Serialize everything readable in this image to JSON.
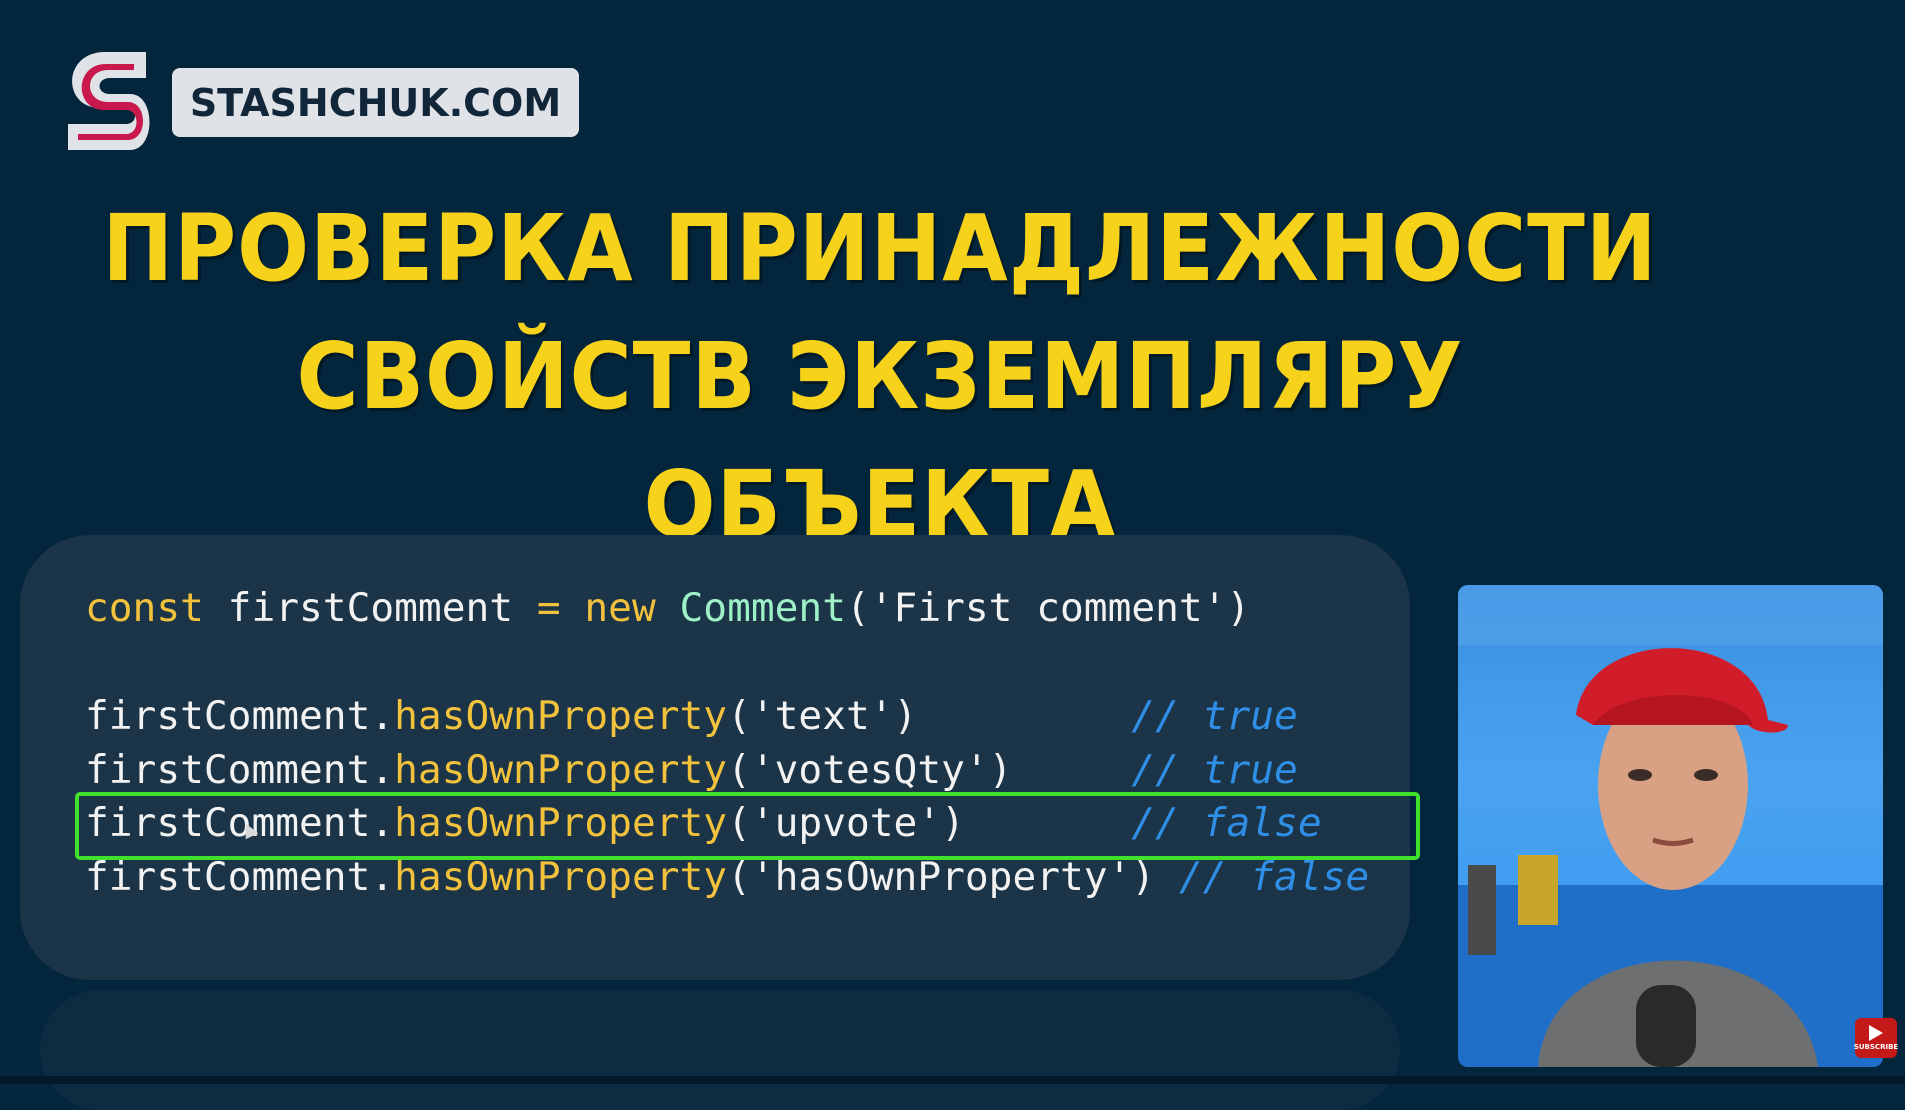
{
  "brand": {
    "site_name": "STASHCHUK.COM",
    "colors": {
      "accent_magenta": "#c8184e",
      "logo_gray": "#dfe2e6"
    }
  },
  "title": {
    "line1": "ПРОВЕРКА ПРИНАДЛЕЖНОСТИ",
    "line2": "СВОЙСТВ ЭКЗЕМПЛЯРУ ОБЪЕКТА",
    "color": "#f7d21a"
  },
  "code": {
    "line1": {
      "kw_const": "const",
      "var": " firstComment ",
      "op": "=",
      "kw_new": " new ",
      "cls": "Comment",
      "args": "('First comment')"
    },
    "lines": [
      {
        "obj": "firstComment.",
        "method": "hasOwnProperty",
        "args": "('text')",
        "pad": "         ",
        "comment": "// true"
      },
      {
        "obj": "firstComment.",
        "method": "hasOwnProperty",
        "args": "('votesQty')",
        "pad": "     ",
        "comment": "// true"
      },
      {
        "obj": "firstComment.",
        "method": "hasOwnProperty",
        "args": "('upvote')",
        "pad": "       ",
        "comment": "// false"
      },
      {
        "obj": "firstComment.",
        "method": "hasOwnProperty",
        "args": "('hasOwnProperty')",
        "pad": " ",
        "comment": "// false"
      }
    ],
    "highlighted_line_index": 2,
    "highlight_color": "#3fe12a"
  },
  "video": {
    "subscribe_label": "SUBSCRIBE"
  }
}
